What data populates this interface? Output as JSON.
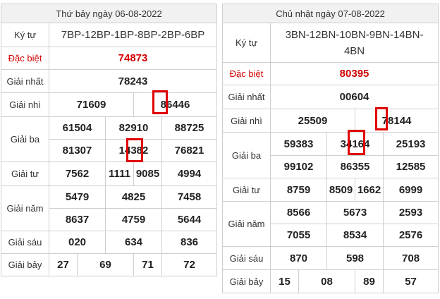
{
  "left": {
    "header": "Thứ bảy ngày 06-08-2022",
    "ky_tu_label": "Ký tự",
    "ky_tu": "7BP-12BP-1BP-8BP-2BP-6BP",
    "dac_biet_label": "Đặc biệt",
    "dac_biet": "74873",
    "nhat_label": "Giải nhất",
    "nhat": "78243",
    "nhi_label": "Giải nhì",
    "nhi": [
      "71609",
      "86446"
    ],
    "ba_label": "Giải ba",
    "ba": [
      "61504",
      "82910",
      "88725",
      "81307",
      "14382",
      "76821"
    ],
    "tu_label": "Giải tư",
    "tu": [
      "7562",
      "1111",
      "9085",
      "4994"
    ],
    "nam_label": "Giải năm",
    "nam": [
      "5479",
      "4825",
      "7458",
      "8637",
      "4759",
      "5644"
    ],
    "sau_label": "Giải sáu",
    "sau": [
      "020",
      "634",
      "836"
    ],
    "bay_label": "Giải bảy",
    "bay": [
      "27",
      "69",
      "71",
      "72"
    ]
  },
  "right": {
    "header": "Chủ nhật ngày 07-08-2022",
    "ky_tu_label": "Ký tự",
    "ky_tu_line1": "3BN-12BN-10BN-9BN-14BN-",
    "ky_tu_line2": "4BN",
    "dac_biet_label": "Đặc biệt",
    "dac_biet": "80395",
    "nhat_label": "Giải nhất",
    "nhat": "00604",
    "nhi_label": "Giải nhì",
    "nhi": [
      "25509",
      "78144"
    ],
    "ba_label": "Giải ba",
    "ba": [
      "59383",
      "34164",
      "25193",
      "99102",
      "86355",
      "12585"
    ],
    "tu_label": "Giải tư",
    "tu": [
      "8759",
      "8509",
      "1662",
      "6999"
    ],
    "nam_label": "Giải năm",
    "nam": [
      "8566",
      "5673",
      "2593",
      "7055",
      "8534",
      "2576"
    ],
    "sau_label": "Giải sáu",
    "sau": [
      "870",
      "598",
      "708"
    ],
    "bay_label": "Giải bảy",
    "bay": [
      "15",
      "08",
      "89",
      "57"
    ]
  },
  "colors": {
    "special": "#d20000",
    "highlight": "#e00000",
    "header_bg": "#f1f1f1",
    "border": "#cfcfcf"
  }
}
